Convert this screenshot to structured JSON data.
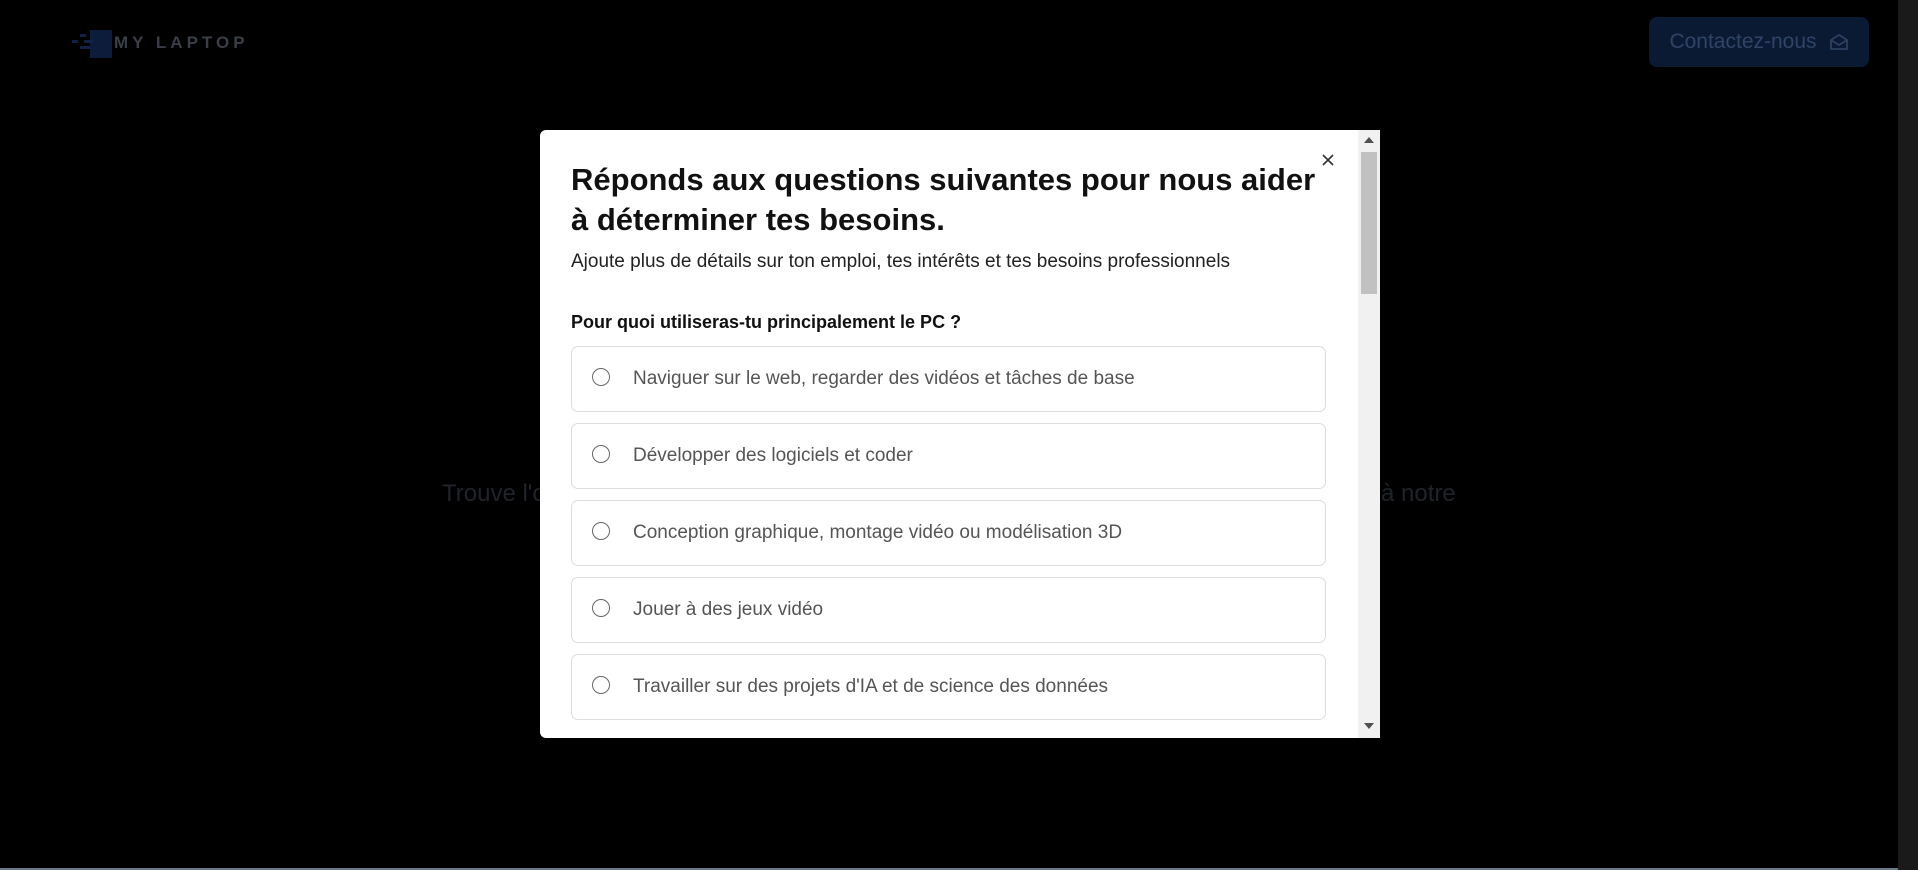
{
  "header": {
    "logo_text": "MY LAPTOP",
    "contact_label": "Contactez-nous",
    "contact_icon": "envelope-open-icon"
  },
  "background": {
    "hero_left": "Trouve l'o",
    "hero_right": "à notre"
  },
  "modal": {
    "close_icon": "close-icon",
    "title": "Réponds aux questions suivantes pour nous aider à déterminer tes besoins.",
    "subtitle": "Ajoute plus de détails sur ton emploi, tes intérêts et tes besoins professionnels",
    "question": "Pour quoi utiliseras-tu principalement le PC ?",
    "options": [
      {
        "label": "Naviguer sur le web, regarder des vidéos et tâches de base",
        "selected": false
      },
      {
        "label": "Développer des logiciels et coder",
        "selected": false
      },
      {
        "label": "Conception graphique, montage vidéo ou modélisation 3D",
        "selected": false
      },
      {
        "label": "Jouer à des jeux vidéo",
        "selected": false
      },
      {
        "label": "Travailler sur des projets d'IA et de science des données",
        "selected": false
      }
    ]
  },
  "colors": {
    "overlay": "#000000",
    "modal_bg": "#ffffff",
    "contact_bg": "#0b1a33"
  }
}
